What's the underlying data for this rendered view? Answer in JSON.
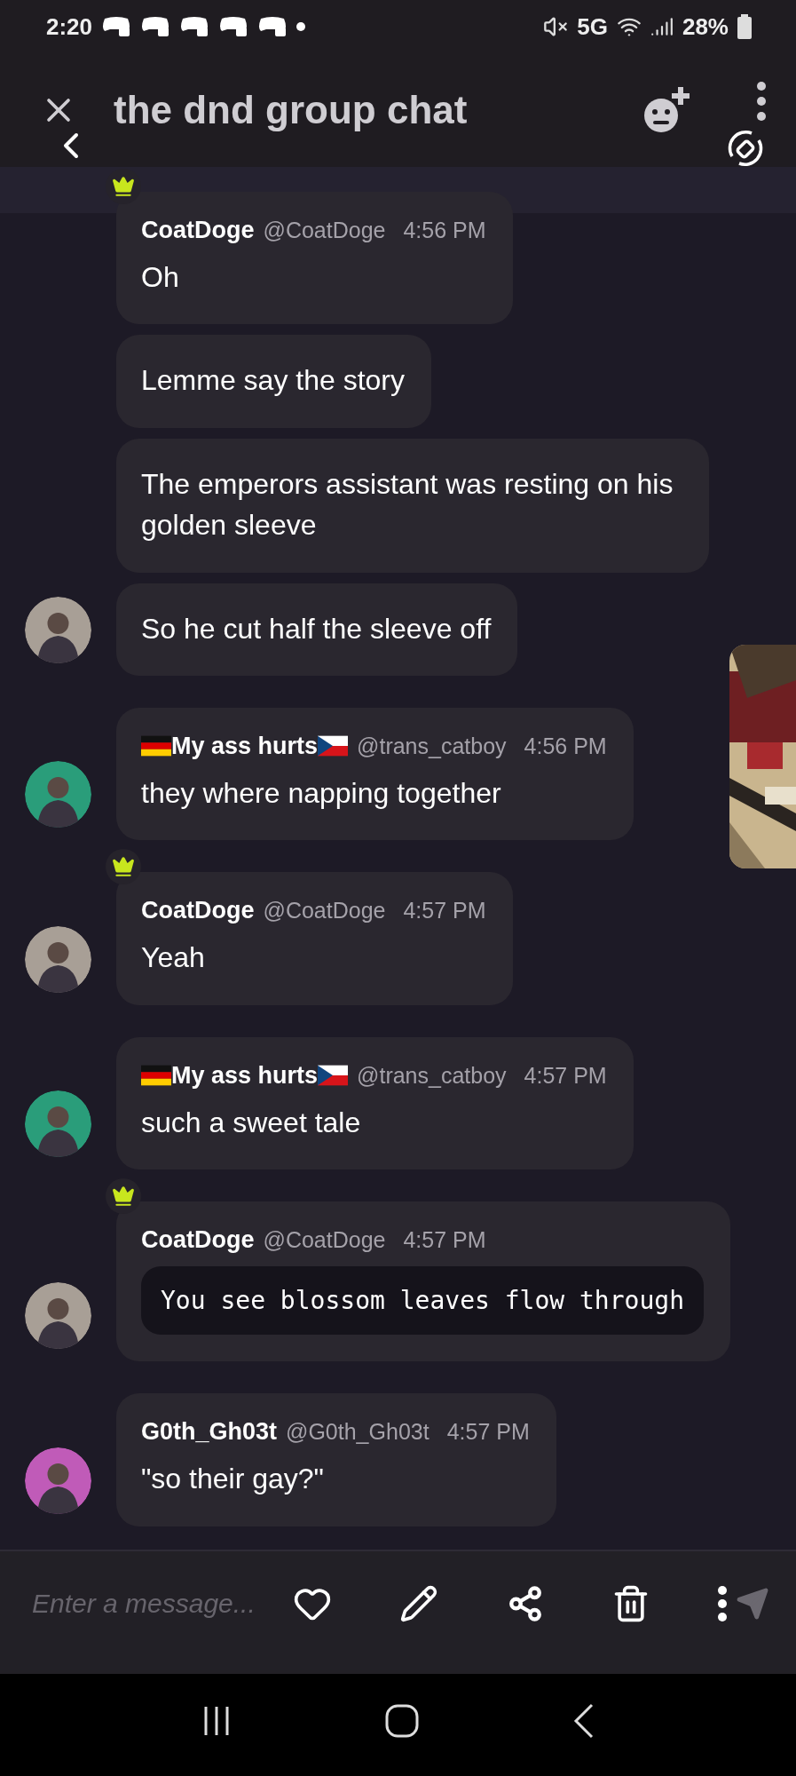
{
  "status_bar": {
    "time": "2:20",
    "network": "5G",
    "battery": "28%"
  },
  "header": {
    "title": "the dnd group chat"
  },
  "messages": [
    {
      "author": "CoatDoge",
      "handle": "@CoatDoge",
      "time": "4:56 PM",
      "crown": true,
      "flagged": false,
      "color": "#a89f96",
      "bubbles": [
        {
          "kind": "text",
          "text": "Oh"
        },
        {
          "kind": "text",
          "text": "Lemme say the story"
        },
        {
          "kind": "text",
          "text": "The emperors assistant was resting on his golden sleeve"
        },
        {
          "kind": "text",
          "text": "So he cut half the sleeve off"
        }
      ]
    },
    {
      "author": "My ass hurts",
      "handle": "@trans_catboy",
      "time": "4:56 PM",
      "crown": false,
      "flagged": true,
      "color": "#2a9d7a",
      "bubbles": [
        {
          "kind": "text",
          "text": "they where napping together"
        }
      ]
    },
    {
      "author": "CoatDoge",
      "handle": "@CoatDoge",
      "time": "4:57 PM",
      "crown": true,
      "flagged": false,
      "color": "#a89f96",
      "bubbles": [
        {
          "kind": "text",
          "text": "Yeah"
        }
      ]
    },
    {
      "author": "My ass hurts",
      "handle": "@trans_catboy",
      "time": "4:57 PM",
      "crown": false,
      "flagged": true,
      "color": "#2a9d7a",
      "bubbles": [
        {
          "kind": "text",
          "text": "such a sweet tale"
        }
      ]
    },
    {
      "author": "CoatDoge",
      "handle": "@CoatDoge",
      "time": "4:57 PM",
      "crown": true,
      "flagged": false,
      "color": "#a89f96",
      "bubbles": [
        {
          "kind": "code",
          "text": "You see blossom leaves flow through"
        }
      ]
    },
    {
      "author": "G0th_Gh03t",
      "handle": "@G0th_Gh03t",
      "time": "4:57 PM",
      "crown": false,
      "flagged": false,
      "color": "#c05bb8",
      "bubbles": [
        {
          "kind": "text",
          "text": "\"so their gay?\""
        }
      ]
    }
  ],
  "composer": {
    "placeholder": "Enter a message..."
  }
}
